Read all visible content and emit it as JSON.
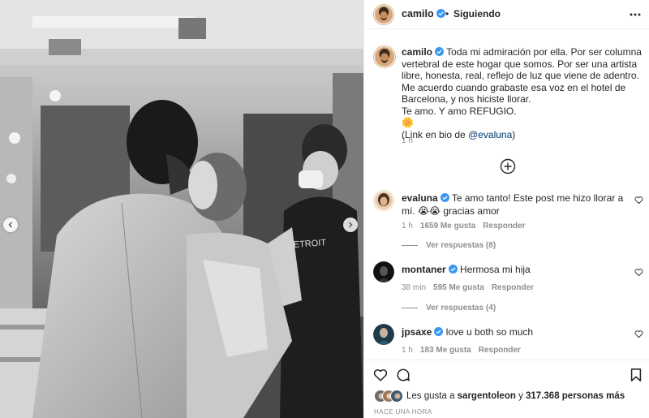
{
  "post": {
    "username": "camilo",
    "follow_status": "Siguiendo",
    "separator": "•",
    "caption": "Toda mi admiración por ella. Por ser columna vertebral de este hogar que somos. Por ser una artista libre, honesta, real, reflejo de luz que viene de adentro.\nMe acuerdo cuando grabaste esa voz en el hotel de Barcelona, y nos hiciste llorar.\nTe amo. Y amo REFUGIO.\n🌼\n(Link en bio de ",
    "caption_mention": "@evaluna",
    "caption_end": ")",
    "time": "1 h"
  },
  "comments": [
    {
      "username": "evaluna",
      "text": "Te amo tanto! Este post me hizo llorar a mí. 😭😭 gracias amor",
      "time": "1 h",
      "likes": "1659 Me gusta",
      "reply": "Responder",
      "view_replies": "Ver respuestas (8)"
    },
    {
      "username": "montaner",
      "text": "Hermosa mi hija",
      "time": "38 min",
      "likes": "595 Me gusta",
      "reply": "Responder",
      "view_replies": "Ver respuestas (4)"
    },
    {
      "username": "jpsaxe",
      "text": "love u both so much",
      "time": "1 h",
      "likes": "183 Me gusta",
      "reply": "Responder"
    }
  ],
  "likes": {
    "prefix": "Les gusta a ",
    "user": "sargentoleon",
    "middle": " y ",
    "count": "317.368 personas más"
  },
  "time_ago": "HACE UNA HORA",
  "colors": {
    "verified": "#3897f0",
    "text": "#262626",
    "muted": "#8e8e8e",
    "link": "#00376b"
  },
  "icons": [
    "more-icon",
    "verified-icon",
    "plus-circle-icon",
    "heart-icon",
    "comment-icon",
    "bookmark-icon",
    "chevron-left-icon",
    "chevron-right-icon"
  ]
}
